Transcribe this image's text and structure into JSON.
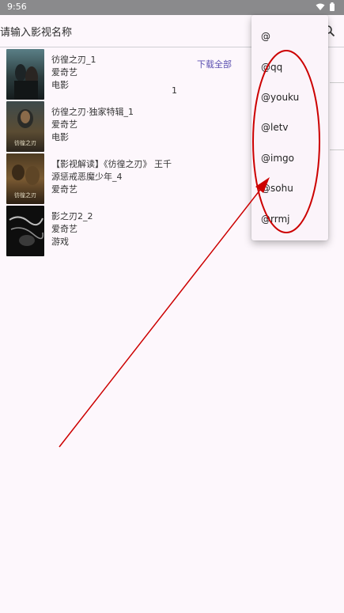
{
  "status_bar": {
    "time": "9:56",
    "icons": [
      "wifi-icon",
      "battery-icon"
    ]
  },
  "search": {
    "placeholder": "请输入影视名称",
    "icon": "search-icon"
  },
  "results": [
    {
      "title": "彷徨之刃_1",
      "source": "爱奇艺",
      "category": "电影",
      "thumb_text": ""
    },
    {
      "title": "彷徨之刃·独家特辑_1",
      "source": "爱奇艺",
      "category": "电影",
      "thumb_text": "彷徨之刃"
    },
    {
      "title": "【影视解读】《彷徨之刃》 王千源惩戒恶魔少年_4",
      "source": "爱奇艺",
      "category": "",
      "thumb_text": "彷徨之刃"
    },
    {
      "title": "影之刃2_2",
      "source": "爱奇艺",
      "category": "游戏",
      "thumb_text": ""
    }
  ],
  "download_all_label": "下载全部",
  "count_label": "1",
  "source_menu": {
    "items": [
      "@",
      "@qq",
      "@youku",
      "@letv",
      "@imgo",
      "@sohu",
      "@rrmj"
    ]
  },
  "colors": {
    "background": "#fdf7fc",
    "status_bar": "#8a8a8c",
    "accent_link": "#5a4fb0",
    "annotation": "#cc0000"
  }
}
